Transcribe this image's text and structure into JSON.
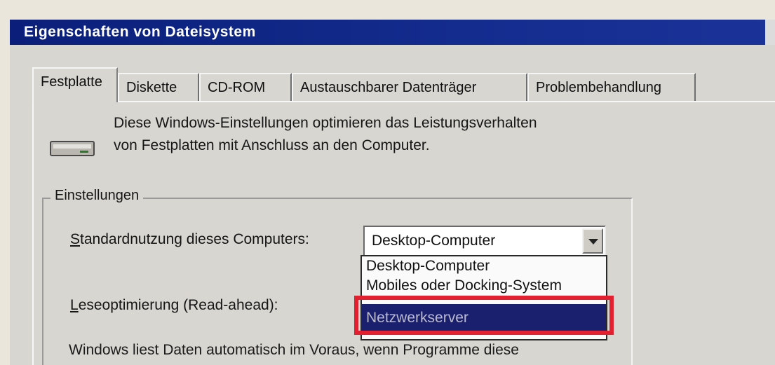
{
  "window": {
    "title": "Eigenschaften von Dateisystem"
  },
  "tabs": [
    {
      "label": "Festplatte",
      "active": true
    },
    {
      "label": "Diskette",
      "active": false
    },
    {
      "label": "CD-ROM",
      "active": false
    },
    {
      "label": "Austauschbarer Datenträger",
      "active": false
    },
    {
      "label": "Problembehandlung",
      "active": false
    }
  ],
  "description": {
    "line1": "Diese Windows-Einstellungen optimieren das Leistungsverhalten",
    "line2": "von Festplatten mit Anschluss an den Computer."
  },
  "settings": {
    "group_label": "Einstellungen",
    "usage_label_key": "S",
    "usage_label_rest": "tandardnutzung dieses Computers:",
    "usage_value": "Desktop-Computer",
    "usage_options": [
      "Desktop-Computer",
      "Mobiles oder Docking-System",
      "Netzwerkserver"
    ],
    "usage_selected_index": 2,
    "readahead_label_key": "L",
    "readahead_label_rest": "eseoptimierung (Read-ahead):",
    "footer_text": "Windows liest Daten automatisch im Voraus, wenn Programme diese"
  },
  "colors": {
    "titlebar": "#0b1f7a",
    "highlight": "#1a1f6e",
    "callout": "#e32030"
  }
}
